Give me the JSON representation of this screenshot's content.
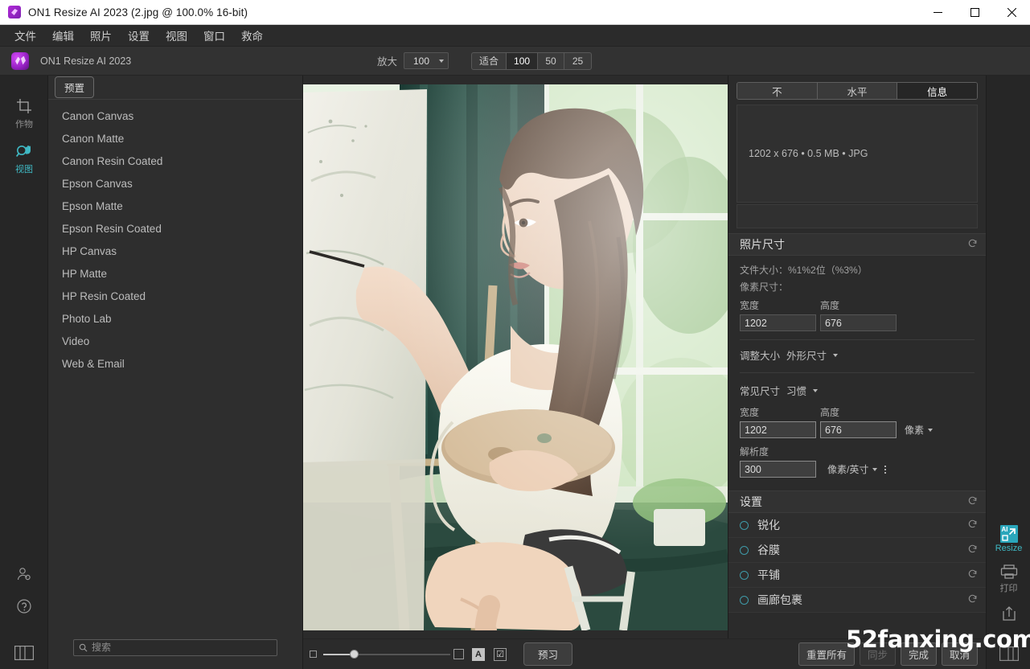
{
  "window": {
    "title": "ON1 Resize AI 2023 (2.jpg @ 100.0% 16-bit)",
    "minimize_label": "minimize",
    "maximize_label": "maximize",
    "close_label": "close"
  },
  "menubar": {
    "items": [
      {
        "label": "文件"
      },
      {
        "label": "编辑"
      },
      {
        "label": "照片"
      },
      {
        "label": "设置"
      },
      {
        "label": "视图"
      },
      {
        "label": "窗口"
      },
      {
        "label": "救命"
      }
    ]
  },
  "toolbar": {
    "brand": "ON1 Resize AI 2023",
    "zoom_label": "放大",
    "zoom_value": "100",
    "fit_label": "适合",
    "zoom_steps": [
      "100",
      "50",
      "25"
    ]
  },
  "left_rail": {
    "tools": [
      {
        "name": "crop",
        "label": "作物",
        "active": false
      },
      {
        "name": "view",
        "label": "视图",
        "active": true
      }
    ],
    "bottom_icons": [
      "account-icon",
      "help-icon",
      "panel-toggle-icon"
    ]
  },
  "presets": {
    "tab_label": "预置",
    "items": [
      {
        "label": "Canon Canvas"
      },
      {
        "label": "Canon Matte"
      },
      {
        "label": "Canon Resin Coated"
      },
      {
        "label": "Epson Canvas"
      },
      {
        "label": "Epson Matte"
      },
      {
        "label": "Epson Resin Coated"
      },
      {
        "label": "HP Canvas"
      },
      {
        "label": "HP Matte"
      },
      {
        "label": "HP Resin Coated"
      },
      {
        "label": "Photo Lab"
      },
      {
        "label": "Video"
      },
      {
        "label": "Web & Email"
      }
    ],
    "search_placeholder": "搜索",
    "search_value": ""
  },
  "canvas": {
    "image_alt": "girl painting at easel"
  },
  "bottombar": {
    "preview_label": "预习",
    "text_tool_label": "A",
    "check_tool_label": "☑"
  },
  "right_panel": {
    "tabs": [
      {
        "label": "不",
        "active": false
      },
      {
        "label": "水平",
        "active": false
      },
      {
        "label": "信息",
        "active": true
      }
    ],
    "info_text": "1202 x 676 • 0.5 MB • JPG",
    "photo_size": {
      "title": "照片尺寸",
      "file_size_line": "文件大小：%1%2位（%3%）",
      "pixel_dims_label": "像素尺寸：",
      "width_label": "宽度",
      "height_label": "高度",
      "width_value": "1202",
      "height_value": "676",
      "resize_label": "调整大小",
      "resize_value": "外形尺寸"
    },
    "common_size": {
      "label": "常见尺寸",
      "value": "习惯",
      "width_label": "宽度",
      "height_label": "高度",
      "width_value": "1202",
      "height_value": "676",
      "unit": "像素",
      "resolution_label": "解析度",
      "resolution_value": "300",
      "resolution_unit": "像素/英寸"
    },
    "settings": {
      "title": "设置",
      "rows": [
        {
          "label": "锐化"
        },
        {
          "label": "谷膜"
        },
        {
          "label": "平铺"
        },
        {
          "label": "画廊包裹"
        }
      ]
    }
  },
  "right_rail": {
    "items": [
      {
        "name": "ai-resize",
        "label": "Resize",
        "badge": "AI",
        "active": true
      },
      {
        "name": "print",
        "label": "打印",
        "active": false
      },
      {
        "name": "share",
        "label": "",
        "active": false
      },
      {
        "name": "panel-toggle",
        "label": "",
        "active": false
      }
    ]
  },
  "bottom_buttons": [
    {
      "label": "重置所有",
      "disabled": false
    },
    {
      "label": "同步",
      "disabled": true
    },
    {
      "label": "完成",
      "disabled": false
    },
    {
      "label": "取消",
      "disabled": false
    }
  ],
  "watermark": {
    "text": "52fanxing.com"
  },
  "colors": {
    "accent_teal": "#3fb9c4",
    "brand_purple": "#b02ad8",
    "panel_bg": "#2b2b2b",
    "titlebar_bg": "#ffffff"
  }
}
